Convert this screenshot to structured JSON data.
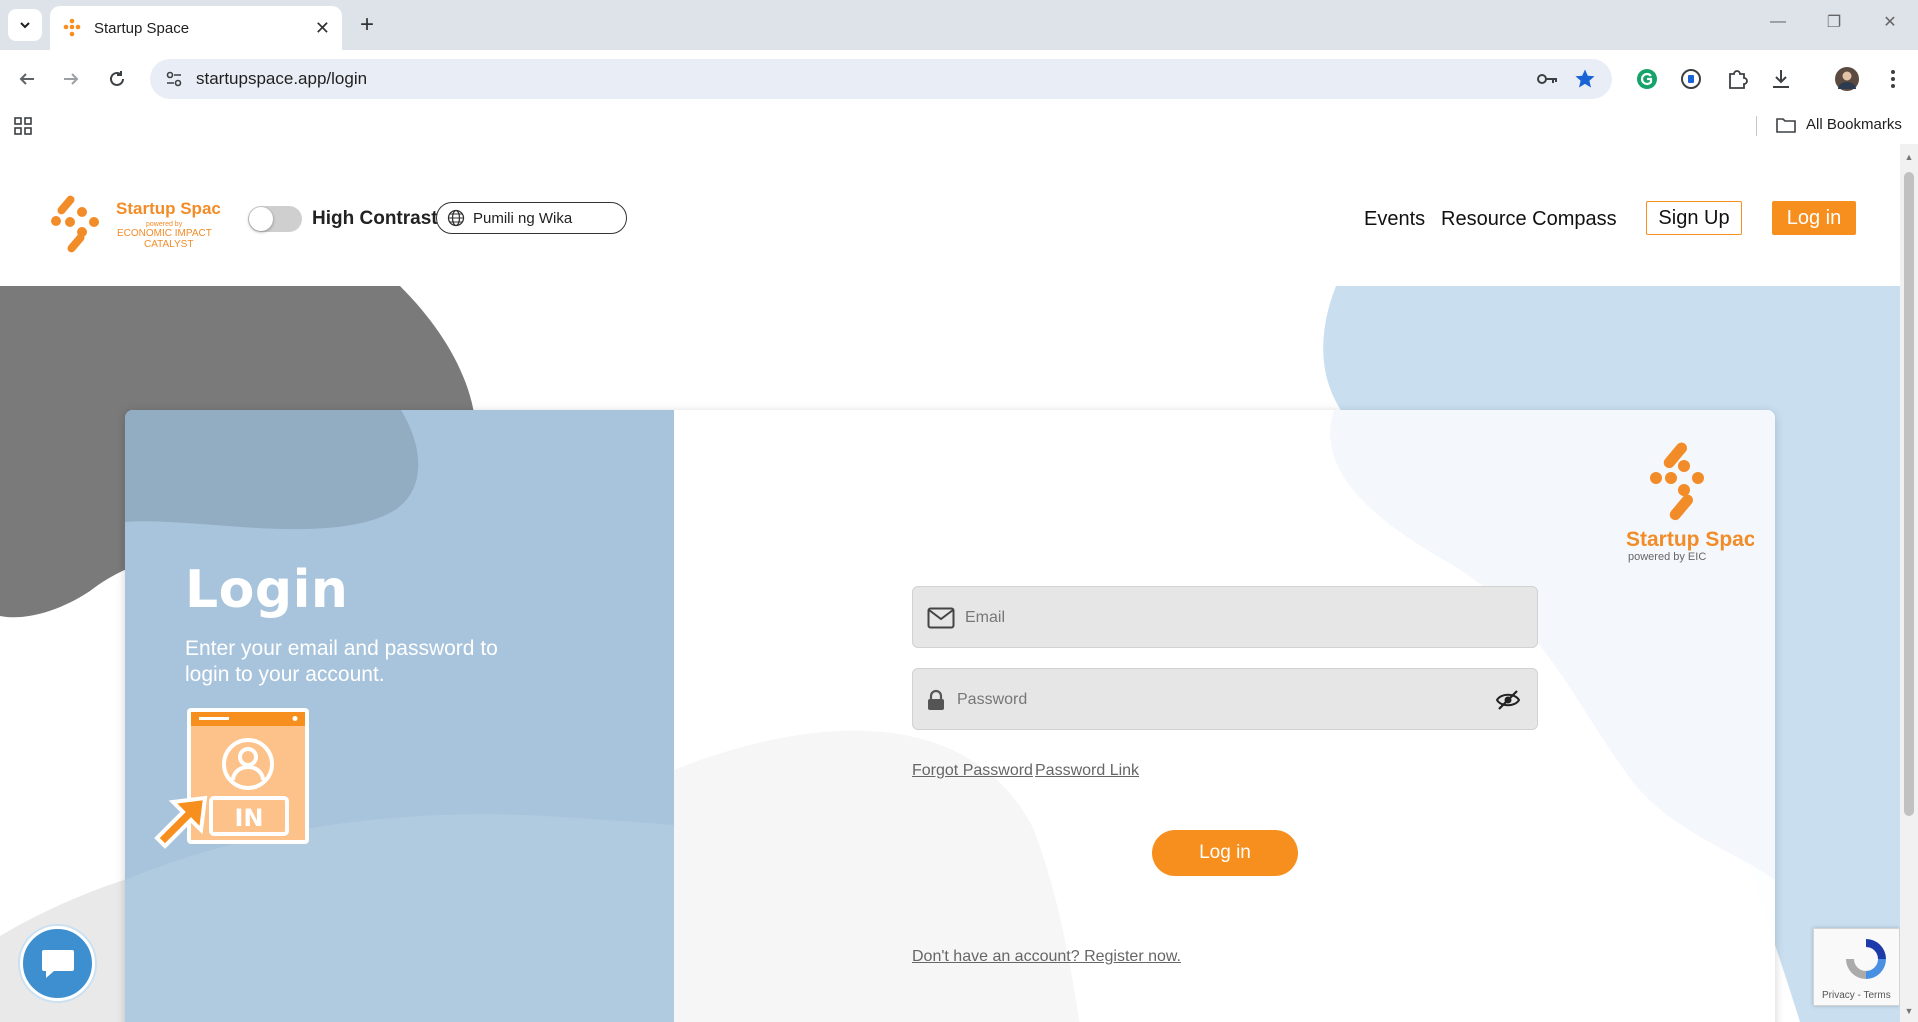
{
  "browser": {
    "tab_title": "Startup Space",
    "tab_close": "✕",
    "new_tab": "+",
    "url": "startupspace.app/login",
    "bookmarks_label": "All Bookmarks",
    "window_controls": [
      "—",
      "❐",
      "✕"
    ]
  },
  "header": {
    "logo_name": "Startup Space",
    "logo_tagline": "powered by",
    "logo_org_1": "ECONOMIC IMPACT",
    "logo_org_2": "CATALYST",
    "high_contrast_label": "High Contrast",
    "language_label": "Pumili ng Wika",
    "nav": {
      "events": "Events",
      "resource_compass": "Resource Compass",
      "sign_up": "Sign Up",
      "log_in": "Log in"
    }
  },
  "login_panel": {
    "title": "Login",
    "subtitle": "Enter your email and password to login to your account.",
    "illustration_text": "IN"
  },
  "login_form": {
    "brand_name": "Startup Space",
    "brand_powered": "powered by EIC",
    "email_placeholder": "Email",
    "password_placeholder": "Password",
    "forgot_password": "Forgot Password",
    "password_link": "Password Link",
    "submit": "Log in",
    "register_prompt": "Don't have an account? Register now."
  },
  "recaptcha": {
    "footer": "Privacy - Terms"
  },
  "colors": {
    "brand_orange": "#f78f1e",
    "panel_blue": "#a8c4dc",
    "blob_gray": "#7a7a7a",
    "blob_lightblue": "#c9dff0",
    "chat_blue": "#3e8fcf"
  },
  "icons": [
    "chevron-down-icon",
    "favicon-icon",
    "back-icon",
    "forward-icon",
    "reload-icon",
    "tune-icon",
    "key-icon",
    "star-icon",
    "grammarly-icon",
    "extension-icon",
    "puzzle-icon",
    "download-icon",
    "avatar",
    "more-icon",
    "apps-icon",
    "folder-icon",
    "globe-icon",
    "mail-icon",
    "lock-icon",
    "eye-off-icon",
    "chat-icon",
    "recaptcha-icon"
  ]
}
